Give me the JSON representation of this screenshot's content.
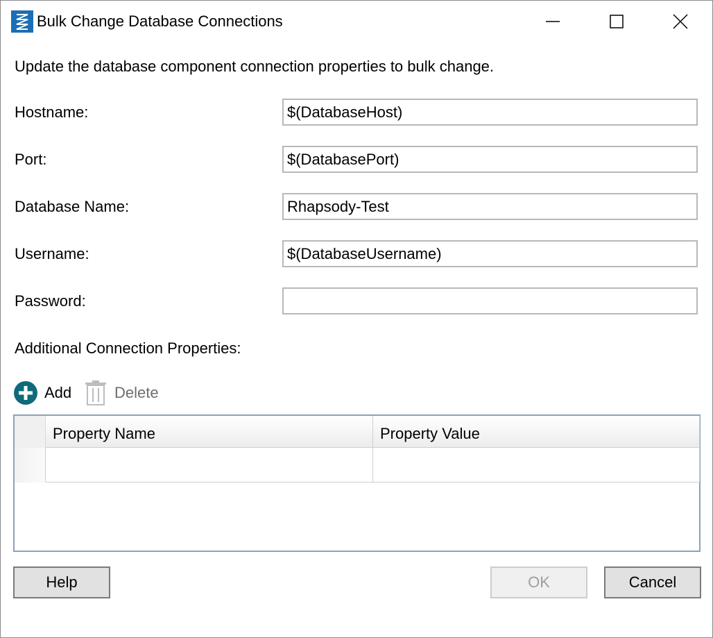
{
  "window": {
    "title": "Bulk Change Database Connections",
    "icon": "app-logo-icon"
  },
  "description": "Update the database component connection properties to bulk change.",
  "fields": [
    {
      "label": "Hostname:",
      "value": "$(DatabaseHost)"
    },
    {
      "label": "Port:",
      "value": "$(DatabasePort)"
    },
    {
      "label": "Database Name:",
      "value": "Rhapsody-Test"
    },
    {
      "label": "Username:",
      "value": "$(DatabaseUsername)"
    },
    {
      "label": "Password:",
      "value": ""
    }
  ],
  "additional": {
    "label": "Additional Connection Properties:",
    "add_label": "Add",
    "delete_label": "Delete",
    "columns": [
      "Property Name",
      "Property Value"
    ]
  },
  "buttons": {
    "help": "Help",
    "ok": "OK",
    "cancel": "Cancel"
  },
  "colors": {
    "accent": "#1b6fb5",
    "add_icon": "#0f6b7a"
  }
}
